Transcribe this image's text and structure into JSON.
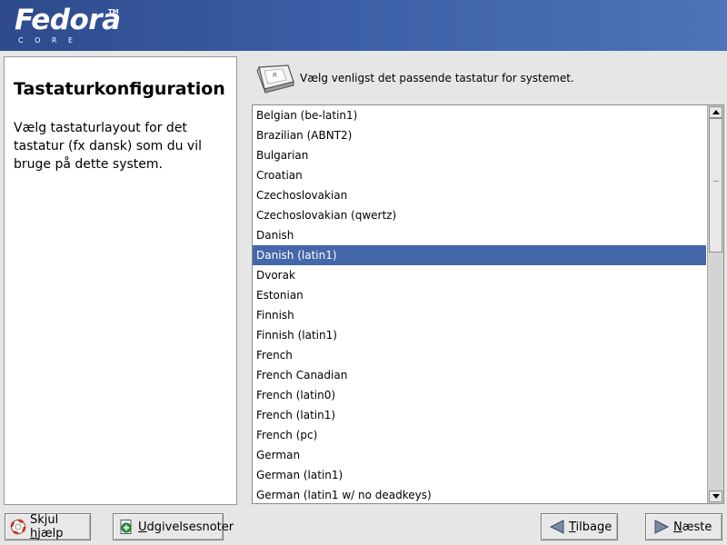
{
  "header": {
    "logo_word": "Fedora",
    "logo_sub": "CORE",
    "logo_tm": "TM",
    "bg_color": "#3b5ea6"
  },
  "help": {
    "title": "Tastaturkonfiguration",
    "body": "Vælg tastaturlayout for det tastatur (fx dansk) som du vil bruge på dette system."
  },
  "main": {
    "instruction": "Vælg venligst det passende tastatur for systemet.",
    "keyboard_icon": "keyboard-key-icon",
    "selected_index": 7,
    "items": [
      "Belgian (be-latin1)",
      "Brazilian (ABNT2)",
      "Bulgarian",
      "Croatian",
      "Czechoslovakian",
      "Czechoslovakian (qwertz)",
      "Danish",
      "Danish (latin1)",
      "Dvorak",
      "Estonian",
      "Finnish",
      "Finnish (latin1)",
      "French",
      "French Canadian",
      "French (latin0)",
      "French (latin1)",
      "French (pc)",
      "German",
      "German (latin1)",
      "German (latin1 w/ no deadkeys)"
    ],
    "selection_color": "#4466aa"
  },
  "buttons": {
    "hide_help": {
      "pre": "Skjul ",
      "key": "h",
      "post": "jælp"
    },
    "release_notes": {
      "pre": "",
      "key": "U",
      "post": "dgivelsesnoter"
    },
    "back": {
      "pre": "",
      "key": "T",
      "post": "ilbage"
    },
    "next": {
      "pre": "",
      "key": "N",
      "post": "æste"
    }
  }
}
